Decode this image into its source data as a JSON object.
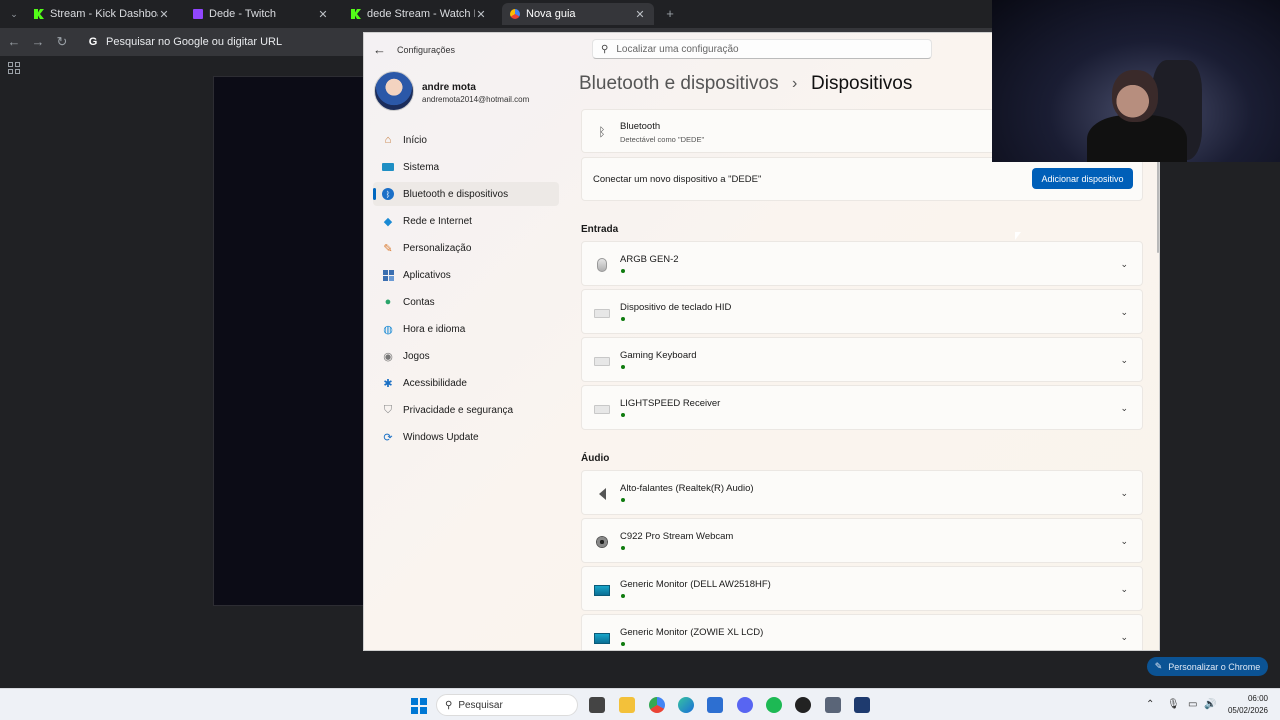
{
  "browser": {
    "tabs": [
      {
        "title": "Stream - Kick Dashboard",
        "favicon": "kick-icon"
      },
      {
        "title": "Dede - Twitch",
        "favicon": "twitch-icon"
      },
      {
        "title": "dede Stream - Watch Live on Ki",
        "favicon": "kick-icon"
      },
      {
        "title": "Nova guia",
        "favicon": "chrome-icon",
        "active": true
      }
    ],
    "omnibox_placeholder": "Pesquisar no Google ou digitar URL",
    "personalize_label": "Personalizar o Chrome"
  },
  "settings": {
    "window_title": "Configurações",
    "search_placeholder": "Localizar uma configuração",
    "user": {
      "name": "andre mota",
      "email": "andremota2014@hotmail.com"
    },
    "nav": [
      {
        "label": "Início",
        "icon": "home-icon"
      },
      {
        "label": "Sistema",
        "icon": "monitor-icon"
      },
      {
        "label": "Bluetooth e dispositivos",
        "icon": "bluetooth-icon",
        "selected": true
      },
      {
        "label": "Rede e Internet",
        "icon": "wifi-icon"
      },
      {
        "label": "Personalização",
        "icon": "brush-icon"
      },
      {
        "label": "Aplicativos",
        "icon": "apps-icon"
      },
      {
        "label": "Contas",
        "icon": "person-icon"
      },
      {
        "label": "Hora e idioma",
        "icon": "globe-clock-icon"
      },
      {
        "label": "Jogos",
        "icon": "gamepad-icon"
      },
      {
        "label": "Acessibilidade",
        "icon": "accessibility-icon"
      },
      {
        "label": "Privacidade e segurança",
        "icon": "shield-icon"
      },
      {
        "label": "Windows Update",
        "icon": "update-icon"
      }
    ],
    "breadcrumb": {
      "parent": "Bluetooth e dispositivos",
      "separator": "›",
      "current": "Dispositivos"
    },
    "bluetooth": {
      "title": "Bluetooth",
      "subtitle": "Detectável como \"DEDE\""
    },
    "connect": {
      "label": "Conectar um novo dispositivo a \"DEDE\"",
      "button": "Adicionar dispositivo"
    },
    "sections": [
      {
        "heading": "Entrada",
        "devices": [
          {
            "name": "ARGB GEN-2",
            "icon": "mouse-icon"
          },
          {
            "name": "Dispositivo de teclado HID",
            "icon": "keyboard-icon"
          },
          {
            "name": "Gaming Keyboard",
            "icon": "keyboard-icon"
          },
          {
            "name": "LIGHTSPEED Receiver",
            "icon": "keyboard-icon"
          }
        ]
      },
      {
        "heading": "Áudio",
        "devices": [
          {
            "name": "Alto-falantes (Realtek(R) Audio)",
            "icon": "speaker-icon"
          },
          {
            "name": "C922 Pro Stream Webcam",
            "icon": "webcam-icon"
          },
          {
            "name": "Generic Monitor (DELL AW2518HF)",
            "icon": "monitor-icon"
          },
          {
            "name": "Generic Monitor (ZOWIE XL LCD)",
            "icon": "monitor-icon"
          }
        ]
      }
    ]
  },
  "taskbar": {
    "search_placeholder": "Pesquisar",
    "time": "06:00",
    "date": "05/02/2026"
  },
  "colors": {
    "accent": "#005fb8",
    "status_connected": "#0f7b0f",
    "kick": "#53fc18",
    "twitch": "#9146ff"
  }
}
